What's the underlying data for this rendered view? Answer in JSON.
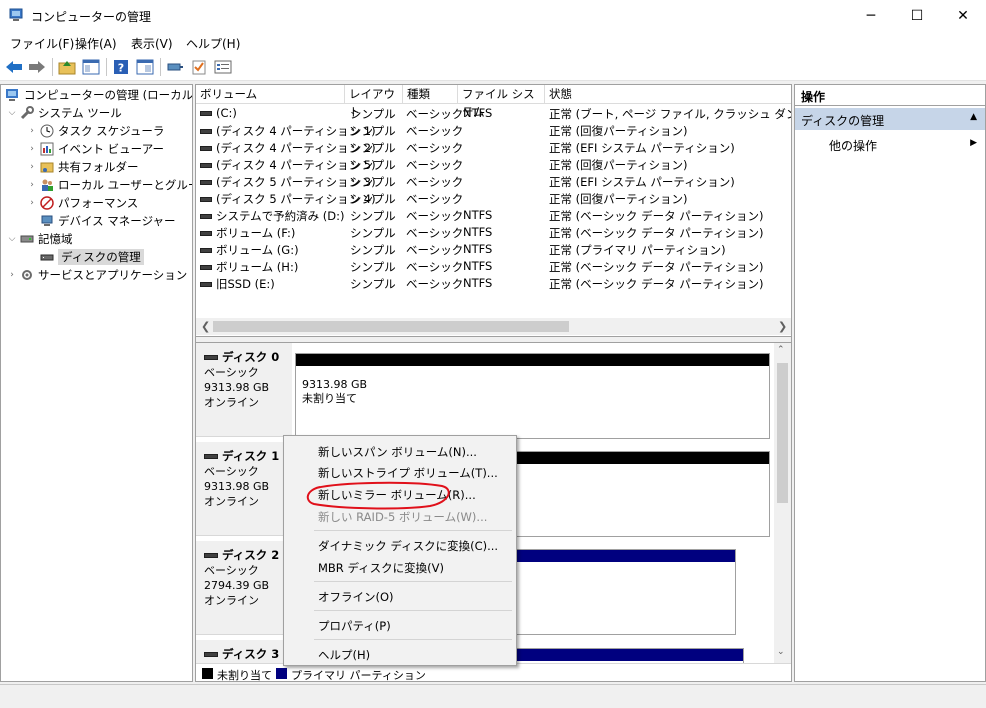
{
  "window": {
    "title": "コンピューターの管理",
    "controls": {
      "minimize": "─",
      "maximize": "☐",
      "close": "✕"
    }
  },
  "menubar": [
    "ファイル(F)",
    "操作(A)",
    "表示(V)",
    "ヘルプ(H)"
  ],
  "toolbar": {
    "icons": [
      "back-arrow-icon",
      "forward-arrow-icon",
      "up-folder-icon",
      "show-hide-tree-icon",
      "help-icon",
      "console-view-icon",
      "connect-icon",
      "check-icon",
      "properties-icon"
    ]
  },
  "tree": {
    "root": "コンピューターの管理 (ローカル)",
    "system_tools": "システム ツール",
    "task_scheduler": "タスク スケジューラ",
    "event_viewer": "イベント ビューアー",
    "shared_folders": "共有フォルダー",
    "local_users": "ローカル ユーザーとグループ",
    "performance": "パフォーマンス",
    "device_manager": "デバイス マネージャー",
    "storage": "記憶域",
    "disk_management": "ディスクの管理",
    "services_apps": "サービスとアプリケーション"
  },
  "volumes": {
    "headers": {
      "volume": "ボリューム",
      "layout": "レイアウト",
      "type": "種類",
      "fs": "ファイル システム",
      "status": "状態"
    },
    "rows": [
      {
        "volume": "(C:)",
        "layout": "シンプル",
        "type": "ベーシック",
        "fs": "NTFS",
        "status": "正常 (ブート, ページ ファイル, クラッシュ ダンプ, ベーシ"
      },
      {
        "volume": "(ディスク 4 パーティション 1)",
        "layout": "シンプル",
        "type": "ベーシック",
        "fs": "",
        "status": "正常 (回復パーティション)"
      },
      {
        "volume": "(ディスク 4 パーティション 2)",
        "layout": "シンプル",
        "type": "ベーシック",
        "fs": "",
        "status": "正常 (EFI システム パーティション)"
      },
      {
        "volume": "(ディスク 4 パーティション 5)",
        "layout": "シンプル",
        "type": "ベーシック",
        "fs": "",
        "status": "正常 (回復パーティション)"
      },
      {
        "volume": "(ディスク 5 パーティション 3)",
        "layout": "シンプル",
        "type": "ベーシック",
        "fs": "",
        "status": "正常 (EFI システム パーティション)"
      },
      {
        "volume": "(ディスク 5 パーティション 4)",
        "layout": "シンプル",
        "type": "ベーシック",
        "fs": "",
        "status": "正常 (回復パーティション)"
      },
      {
        "volume": "システムで予約済み (D:)",
        "layout": "シンプル",
        "type": "ベーシック",
        "fs": "NTFS",
        "status": "正常 (ベーシック データ パーティション)"
      },
      {
        "volume": "ボリューム (F:)",
        "layout": "シンプル",
        "type": "ベーシック",
        "fs": "NTFS",
        "status": "正常 (ベーシック データ パーティション)"
      },
      {
        "volume": "ボリューム (G:)",
        "layout": "シンプル",
        "type": "ベーシック",
        "fs": "NTFS",
        "status": "正常 (プライマリ パーティション)"
      },
      {
        "volume": "ボリューム (H:)",
        "layout": "シンプル",
        "type": "ベーシック",
        "fs": "NTFS",
        "status": "正常 (ベーシック データ パーティション)"
      },
      {
        "volume": "旧SSD (E:)",
        "layout": "シンプル",
        "type": "ベーシック",
        "fs": "NTFS",
        "status": "正常 (ベーシック データ パーティション)"
      }
    ]
  },
  "disks": [
    {
      "name": "ディスク 0",
      "type": "ベーシック",
      "size": "9313.98 GB",
      "state": "オンライン",
      "part_size": "9313.98 GB",
      "part_label": "未割り当て",
      "band_color": "#000000"
    },
    {
      "name": "ディスク 1",
      "type": "ベーシック",
      "size": "9313.98 GB",
      "state": "オンライン",
      "part_size": "",
      "part_label": "",
      "band_color": "#000000"
    },
    {
      "name": "ディスク 2",
      "type": "ベーシック",
      "size": "2794.39 GB",
      "state": "オンライン",
      "part_size": "",
      "part_label": "",
      "band_color": "#00007f"
    },
    {
      "name": "ディスク 3",
      "type": "",
      "size": "",
      "state": "",
      "part_size": "",
      "part_label": "",
      "band_color": "#00007f"
    }
  ],
  "legend": [
    {
      "label": "未割り当て",
      "color": "#000000"
    },
    {
      "label": "プライマリ パーティション",
      "color": "#00007f"
    }
  ],
  "actions": {
    "header": "操作",
    "section": "ディスクの管理",
    "other": "他の操作"
  },
  "context_menu": {
    "items": [
      {
        "label": "新しいスパン ボリューム(N)...",
        "disabled": false
      },
      {
        "label": "新しいストライプ ボリューム(T)...",
        "disabled": false
      },
      {
        "label": "新しいミラー ボリューム(R)...",
        "disabled": false,
        "highlighted": true
      },
      {
        "label": "新しい RAID-5 ボリューム(W)...",
        "disabled": true
      },
      {
        "label": "ダイナミック ディスクに変換(C)...",
        "disabled": false
      },
      {
        "label": "MBR ディスクに変換(V)",
        "disabled": false
      },
      {
        "label": "オフライン(O)",
        "disabled": false
      },
      {
        "label": "プロパティ(P)",
        "disabled": false
      },
      {
        "label": "ヘルプ(H)",
        "disabled": false
      }
    ],
    "annotation_color": "#e0101a"
  }
}
